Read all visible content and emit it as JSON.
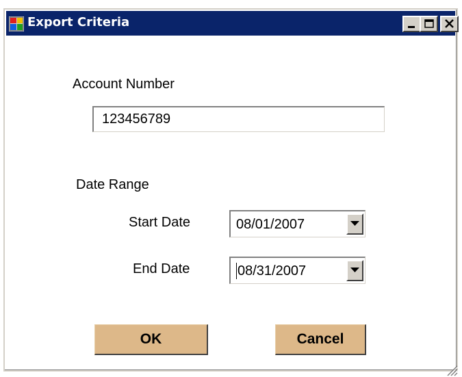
{
  "window": {
    "title": "Export Criteria",
    "titlebar_color": "#0a246a",
    "face_color": "#d4d0c8"
  },
  "titlebar_buttons": {
    "minimize": "minimize-icon",
    "maximize": "maximize-icon",
    "close": "close-icon"
  },
  "account": {
    "label": "Account Number",
    "value": "123456789"
  },
  "date_range": {
    "label": "Date Range",
    "start": {
      "label": "Start Date",
      "value": "08/01/2007"
    },
    "end": {
      "label": "End Date",
      "value": "08/31/2007"
    }
  },
  "buttons": {
    "ok": "OK",
    "cancel": "Cancel",
    "color": "#ddb889"
  }
}
